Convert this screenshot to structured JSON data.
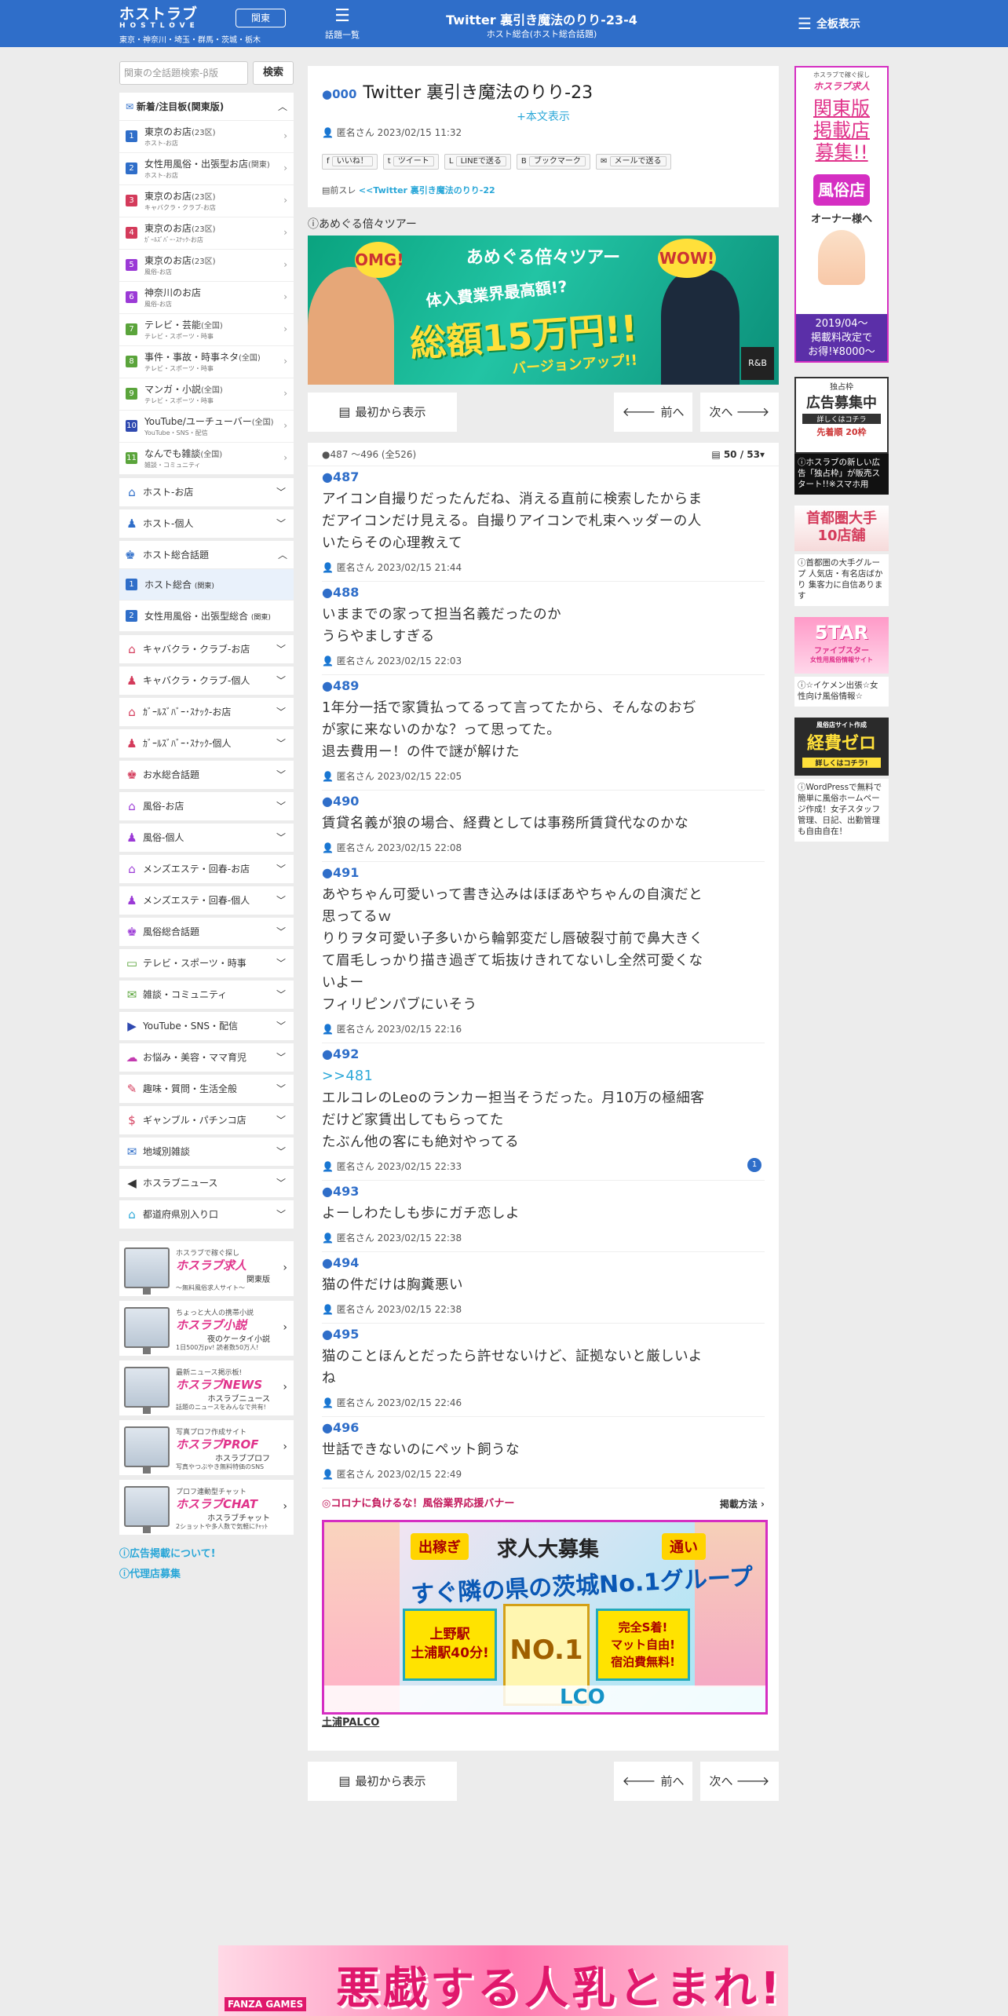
{
  "header": {
    "logo": "ホストラブ",
    "logo_sub": "HOSTLOVE",
    "region": "関東",
    "areas": "東京・神奈川・埼玉・群馬・茨城・栃木",
    "topic_list": "話題一覧",
    "title": "Twitter 裏引き魔法のりり-23-4",
    "subtitle": "ホスト総合(ホスト総合話題)",
    "menu": "全板表示"
  },
  "search": {
    "placeholder": "関東の全話題検索-β版",
    "button": "検索"
  },
  "new_board": {
    "title": "新着/注目板(関東版)",
    "items": [
      {
        "num": "1",
        "color": "#2f6ec9",
        "label": "東京のお店",
        "suffix": "(23区)",
        "sub": "ホスト-お店"
      },
      {
        "num": "2",
        "color": "#2f6ec9",
        "label": "女性用風俗・出張型お店",
        "suffix": "(関東)",
        "sub": "ホスト-お店"
      },
      {
        "num": "3",
        "color": "#d43b5b",
        "label": "東京のお店",
        "suffix": "(23区)",
        "sub": "キャバクラ・クラブ-お店"
      },
      {
        "num": "4",
        "color": "#d43b5b",
        "label": "東京のお店",
        "suffix": "(23区)",
        "sub": "ｶﾞｰﾙｽﾞﾊﾞｰ･ｽﾅｯｸ-お店"
      },
      {
        "num": "5",
        "color": "#9b3ad6",
        "label": "東京のお店",
        "suffix": "(23区)",
        "sub": "風俗-お店"
      },
      {
        "num": "6",
        "color": "#9b3ad6",
        "label": "神奈川のお店",
        "suffix": "",
        "sub": "風俗-お店"
      },
      {
        "num": "7",
        "color": "#5aa43b",
        "label": "テレビ・芸能",
        "suffix": "(全国)",
        "sub": "テレビ・スポーツ・時事"
      },
      {
        "num": "8",
        "color": "#5aa43b",
        "label": "事件・事故・時事ネタ",
        "suffix": "(全国)",
        "sub": "テレビ・スポーツ・時事"
      },
      {
        "num": "9",
        "color": "#5aa43b",
        "label": "マンガ・小説",
        "suffix": "(全国)",
        "sub": "テレビ・スポーツ・時事"
      },
      {
        "num": "10",
        "color": "#2f49b0",
        "label": "YouTube/ユーチューバー",
        "suffix": "(全国)",
        "sub": "YouTube・SNS・配信"
      },
      {
        "num": "11",
        "color": "#5aa43b",
        "label": "なんでも雑談",
        "suffix": "(全国)",
        "sub": "雑談・コミュニティ"
      }
    ]
  },
  "categories_top": [
    {
      "label": "ホスト-お店",
      "icon": "⌂",
      "color": "#2f6ec9"
    },
    {
      "label": "ホスト-個人",
      "icon": "♟",
      "color": "#2f6ec9"
    }
  ],
  "host_general": {
    "label": "ホスト総合話題",
    "icon": "♚",
    "color": "#2f6ec9",
    "items": [
      {
        "num": "1",
        "label": "ホスト総合",
        "suffix": "(関東)"
      },
      {
        "num": "2",
        "label": "女性用風俗・出張型総合",
        "suffix": "(関東)"
      }
    ]
  },
  "categories": [
    {
      "label": "キャバクラ・クラブ-お店",
      "icon": "⌂",
      "color": "#d43b5b"
    },
    {
      "label": "キャバクラ・クラブ-個人",
      "icon": "♟",
      "color": "#d43b5b"
    },
    {
      "label": "ｶﾞｰﾙｽﾞﾊﾞｰ･ｽﾅｯｸ-お店",
      "icon": "⌂",
      "color": "#d43b5b"
    },
    {
      "label": "ｶﾞｰﾙｽﾞﾊﾞｰ･ｽﾅｯｸ-個人",
      "icon": "♟",
      "color": "#d43b5b"
    },
    {
      "label": "お水総合話題",
      "icon": "♚",
      "color": "#d43b5b"
    },
    {
      "label": "風俗-お店",
      "icon": "⌂",
      "color": "#9b3ad6"
    },
    {
      "label": "風俗-個人",
      "icon": "♟",
      "color": "#9b3ad6"
    },
    {
      "label": "メンズエステ・回春-お店",
      "icon": "⌂",
      "color": "#9b3ad6"
    },
    {
      "label": "メンズエステ・回春-個人",
      "icon": "♟",
      "color": "#9b3ad6"
    },
    {
      "label": "風俗総合話題",
      "icon": "♚",
      "color": "#9b3ad6"
    },
    {
      "label": "テレビ・スポーツ・時事",
      "icon": "▭",
      "color": "#5aa43b"
    },
    {
      "label": "雑談・コミュニティ",
      "icon": "✉",
      "color": "#5aa43b"
    },
    {
      "label": "YouTube・SNS・配信",
      "icon": "▶",
      "color": "#2f49b0"
    },
    {
      "label": "お悩み・美容・ママ育児",
      "icon": "☁",
      "color": "#c33bb0"
    },
    {
      "label": "趣味・質問・生活全般",
      "icon": "✎",
      "color": "#d43b5b"
    },
    {
      "label": "ギャンブル・パチンコ店",
      "icon": "$",
      "color": "#d43b5b"
    },
    {
      "label": "地域別雑談",
      "icon": "✉",
      "color": "#2f6ec9"
    },
    {
      "label": "ホスラブニュース",
      "icon": "◀",
      "color": "#333333"
    },
    {
      "label": "都道府県別入り口",
      "icon": "⌂",
      "color": "#2aa7d8"
    }
  ],
  "promos": [
    {
      "top": "ホスラブで稼ぐ探し",
      "brand": "ホスラブ求人",
      "tag": "関東版",
      "desc": "〜無料風俗求人サイト〜"
    },
    {
      "top": "ちょっと大人の携帯小説",
      "brand": "ホスラブ小説",
      "tag": "夜のケータイ小説",
      "desc": "1日500万pv! 読者数50万人!"
    },
    {
      "top": "最新ニュース掲示板!",
      "brand": "ホスラブNEWS",
      "tag": "ホスラブニュース",
      "desc": "話題のニュースをみんなで共有!"
    },
    {
      "top": "写真プロフ作成サイト",
      "brand": "ホスラブPROF",
      "tag": "ホスラブプロフ",
      "desc": "写真やつぶやき無料特価のSNS"
    },
    {
      "top": "プロフ連動型チャット",
      "brand": "ホスラブCHAT",
      "tag": "ホスラブチャット",
      "desc": "2ショットや多人数で気軽にﾁｬｯﾄ"
    }
  ],
  "side_links": [
    "広告掲載について!",
    "代理店募集"
  ],
  "thread": {
    "count": "000",
    "title": "Twitter 裏引き魔法のりり-23",
    "show_body": "+本文表示",
    "author": "匿名さん",
    "datetime": "2023/02/15 11:32",
    "prev_label": "前スレ",
    "prev_link": "<<Twitter 裏引き魔法のりり-22",
    "share": [
      "いいね！",
      "ツイート",
      "LINEで送る",
      "ブックマーク",
      "メールで送る"
    ]
  },
  "ad1": {
    "label": "あめぐる倍々ツアー",
    "title": "あめぐる倍々ツアー",
    "line1": "体入費業界最高額!?",
    "line2": "総額15万円!!",
    "line3": "バージョンアップ!!",
    "omg": "OMG!",
    "wow": "WOW!",
    "logo": "R&B"
  },
  "nav": {
    "first": "最初から表示",
    "prev": "前へ",
    "next": "次へ"
  },
  "posts_head": {
    "range": "487 ～496 (全526)",
    "page": "50 / 53"
  },
  "posts": [
    {
      "num": "487",
      "lines": [
        "アイコン自撮りだったんだね、消える直前に検索したからま",
        "だアイコンだけ見える。自撮りアイコンで札束ヘッダーの人",
        "いたらその心理教えて"
      ],
      "author": "匿名さん",
      "dt": "2023/02/15 21:44"
    },
    {
      "num": "488",
      "lines": [
        "いままでの家って担当名義だったのか",
        "うらやましすぎる"
      ],
      "author": "匿名さん",
      "dt": "2023/02/15 22:03"
    },
    {
      "num": "489",
      "lines": [
        "1年分一括で家賃払ってるって言ってたから、そんなのおぢ",
        "が家に来ないのかな？って思ってた。",
        "退去費用ー！の件で謎が解けた"
      ],
      "author": "匿名さん",
      "dt": "2023/02/15 22:05"
    },
    {
      "num": "490",
      "lines": [
        "賃貸名義が狼の場合、経費としては事務所賃貸代なのかな"
      ],
      "author": "匿名さん",
      "dt": "2023/02/15 22:08"
    },
    {
      "num": "491",
      "lines": [
        "あやちゃん可愛いって書き込みはほぼあやちゃんの自演だと",
        "思ってるｗ",
        "りりヲタ可愛い子多いから輪郭変だし唇破裂寸前で鼻大きく",
        "て眉毛しっかり描き過ぎて垢抜けきれてないし全然可愛くな",
        "いよー",
        "フィリピンパブにいそう"
      ],
      "author": "匿名さん",
      "dt": "2023/02/15 22:16"
    },
    {
      "num": "492",
      "reply": ">>481",
      "lines": [
        "エルコレのLeoのランカー担当そうだった。月10万の極細客",
        "だけど家賃出してもらってた",
        "たぶん他の客にも絶対やってる"
      ],
      "author": "匿名さん",
      "dt": "2023/02/15 22:33",
      "badge": "1"
    },
    {
      "num": "493",
      "lines": [
        "よーしわたしも歩にガチ恋しよ"
      ],
      "author": "匿名さん",
      "dt": "2023/02/15 22:38"
    },
    {
      "num": "494",
      "lines": [
        "猫の件だけは胸糞悪い"
      ],
      "author": "匿名さん",
      "dt": "2023/02/15 22:38"
    },
    {
      "num": "495",
      "lines": [
        "猫のことほんとだったら許せないけど、証拠ないと厳しいよ",
        "ね"
      ],
      "author": "匿名さん",
      "dt": "2023/02/15 22:46"
    },
    {
      "num": "496",
      "lines": [
        "世話できないのにペット飼うな"
      ],
      "author": "匿名さん",
      "dt": "2023/02/15 22:49"
    }
  ],
  "corona": {
    "label": "◎コロナに負けるな！風俗業界応援バナー",
    "how": "掲載方法"
  },
  "ad2": {
    "tag1": "出稼ぎ",
    "head": "求人大募集",
    "tag2": "通い",
    "line": "すぐ隣の県の茨城No.1グループ",
    "box1a": "上野駅",
    "box1b": "土浦駅40分!",
    "box2": "NO.1",
    "box3a": "完全S着!",
    "box3b": "マット自由!",
    "box3c": "宿泊費無料!",
    "foot": "LCO",
    "name": "土浦PALCO"
  },
  "bottom_ad": {
    "text": "悪戯する人乳とまれ!!",
    "brand": "FANZA GAMES"
  },
  "right": {
    "ad1": {
      "top": "ホスラブで稼ぐ探し",
      "brand": "ホスラブ求人",
      "l1": "関東版",
      "l2": "掲載店",
      "l3": "募集!!",
      "l4": "風俗店",
      "l5": "オーナー様へ",
      "l6": "2019/04〜",
      "l7": "掲載料改定で",
      "l8": "お得!¥8000〜"
    },
    "ad2": {
      "l1": "独占枠",
      "l2": "広告募集中",
      "l3": "詳しくはコチラ",
      "l4": "先着順 20枠",
      "text": "ホスラブの新しい広告「独占枠」が販売スタート!!※スマホ用"
    },
    "ad3": {
      "l1": "首都圏大手",
      "l2": "10店舗",
      "text": "首都圏の大手グループ 人気店・有名店ばかり 集客力に自信あります"
    },
    "ad4": {
      "l1": "5TAR",
      "l2": "ファイブスター",
      "l3": "女性用風俗情報サイト",
      "text": "☆イケメン出張☆女性向け風俗情報☆"
    },
    "ad5": {
      "l1": "風俗店サイト作成",
      "l2": "経費ゼロ",
      "l3": "詳しくはコチラ!",
      "text": "WordPressで無料で簡単に風俗ホームページ作成！女子スタッフ管理、日記、出勤管理も自由自在！"
    }
  }
}
